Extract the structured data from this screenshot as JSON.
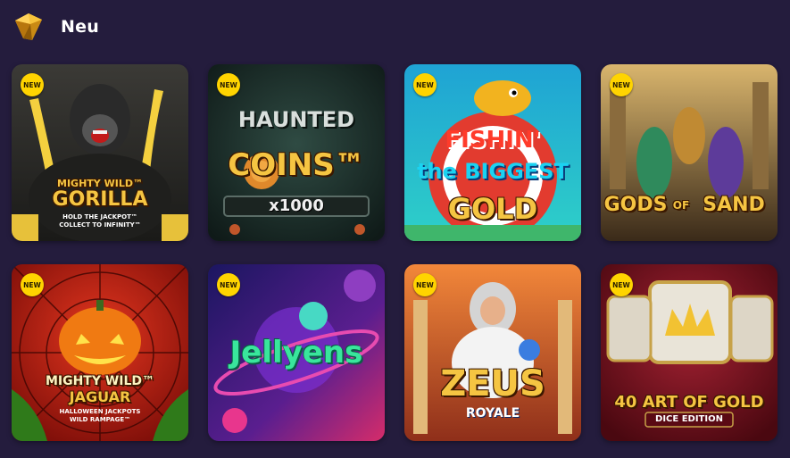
{
  "section": {
    "title": "Neu",
    "icon": "gem-icon"
  },
  "badge_label": "NEW",
  "games": [
    {
      "id": "mighty-wild-gorilla",
      "line1": "MIGHTY WILD™",
      "line2": "GORILLA",
      "line3": "HOLD THE JACKPOT™",
      "line4": "COLLECT TO INFINITY™",
      "bg": "#2b2a28"
    },
    {
      "id": "haunted-coins",
      "line1": "HAUNTED",
      "line2": "COINS™",
      "line3": "x1000",
      "bg": "#1d2f2b"
    },
    {
      "id": "fishin-the-biggest-gold",
      "line1": "FISHIN'",
      "line2": "the BIGGEST",
      "line3": "GOLD",
      "bg": "#24a7c9"
    },
    {
      "id": "gods-of-sand",
      "line1": "GODS",
      "line2": "OF",
      "line3": "SAND",
      "bg": "#6b5a3d"
    },
    {
      "id": "mighty-wild-jaguar",
      "line1": "MIGHTY WILD™",
      "line2": "JAGUAR",
      "line3": "HALLOWEEN JACKPOTS",
      "line4": "WILD RAMPAGE™",
      "bg": "#b8190f"
    },
    {
      "id": "jellyens",
      "line1": "Jellyens",
      "bg": "#3a1f7a"
    },
    {
      "id": "zeus-royale",
      "line1": "ZEUS",
      "line2": "ROYALE",
      "bg": "#c9552a"
    },
    {
      "id": "40-art-of-gold",
      "line1": "40 ART OF GOLD",
      "line2": "DICE EDITION",
      "bg": "#7b1422"
    }
  ]
}
